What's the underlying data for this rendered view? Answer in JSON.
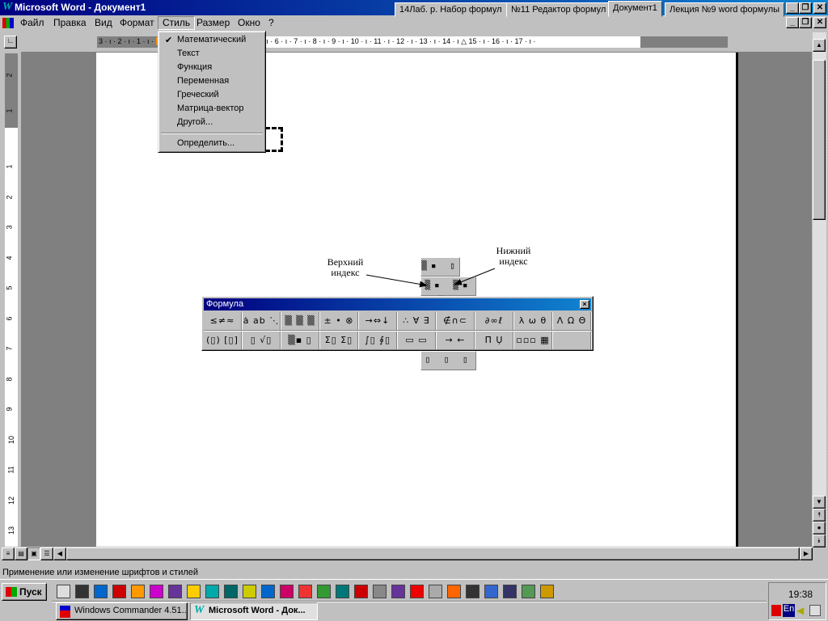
{
  "window": {
    "title": "Microsoft Word - Документ1",
    "doc_tabs": [
      "14Лаб. р. Набор формул",
      "№11 Редактор формул",
      "Документ1",
      "Лекция №9 word формулы"
    ],
    "active_tab": 2
  },
  "menubar": {
    "items": [
      "Файл",
      "Правка",
      "Вид",
      "Формат",
      "Стиль",
      "Размер",
      "Окно",
      "?"
    ],
    "open": "Стиль"
  },
  "style_menu": {
    "items": [
      {
        "label": "Математический",
        "checked": true
      },
      {
        "label": "Текст"
      },
      {
        "label": "Функция"
      },
      {
        "label": "Переменная"
      },
      {
        "label": "Греческий"
      },
      {
        "label": "Матрица-вектор"
      },
      {
        "label": "Другой..."
      },
      {
        "label": "Определить..."
      }
    ],
    "check_glyph": "✔"
  },
  "ruler": {
    "text": "3 · ı · 2 · ı · 1 · ı · 🔽 · ı · 1 · ı · 2 · ı · 3 · ı · 4 · ı · 5 · ı · 6 · ı · 7 · ı · 8 · ı · 9 · ı · 10 · ı · 11 · ı · 12 · ı · 13 · ı · 14 · ı △ 15 · ı · 16 · ı · 17 · ı ·",
    "vlabels": [
      "2",
      "1",
      "1",
      "2",
      "3",
      "4",
      "5",
      "6",
      "7",
      "8",
      "9",
      "10",
      "11",
      "12",
      "13"
    ]
  },
  "annotations": {
    "superscript": "Верхний индекс",
    "subscript": "Нижний индекс"
  },
  "formula_toolbar": {
    "title": "Формула",
    "close": "×",
    "row1": [
      "≤≠≈",
      "ȧ ab ⋱",
      "▒ ▒ ▒",
      "± • ⊗",
      "→⇔↓",
      "∴ ∀ ∃",
      "∉∩⊂",
      "∂∞ℓ",
      "λ ω θ",
      "Λ Ω Θ"
    ],
    "row2": [
      "(▯) [▯]",
      "▯ √▯",
      "▒▪ ▯",
      "Σ▯ Σ▯",
      "∫▯ ∮▯",
      "▭ ▭",
      "→ ←",
      "Π̄ Ụ",
      "▫▫▫ ▦",
      ""
    ],
    "popup_top": "▒▪ ▯",
    "popup_scripts": "▒▪ ▒▪ ▒▪",
    "popup_bottom": "▯ ▯ ▯"
  },
  "status": {
    "text": "Применение или изменение шрифтов и стилей"
  },
  "taskbar": {
    "start": "Пуск",
    "tasks": [
      "Windows Commander 4.51...",
      "Microsoft Word - Док..."
    ],
    "clock": "19:38",
    "lang": "En"
  },
  "colors": {
    "title_start": "#000080",
    "title_end": "#1084d0",
    "face": "#c0c0c0",
    "workspace": "#808080"
  }
}
